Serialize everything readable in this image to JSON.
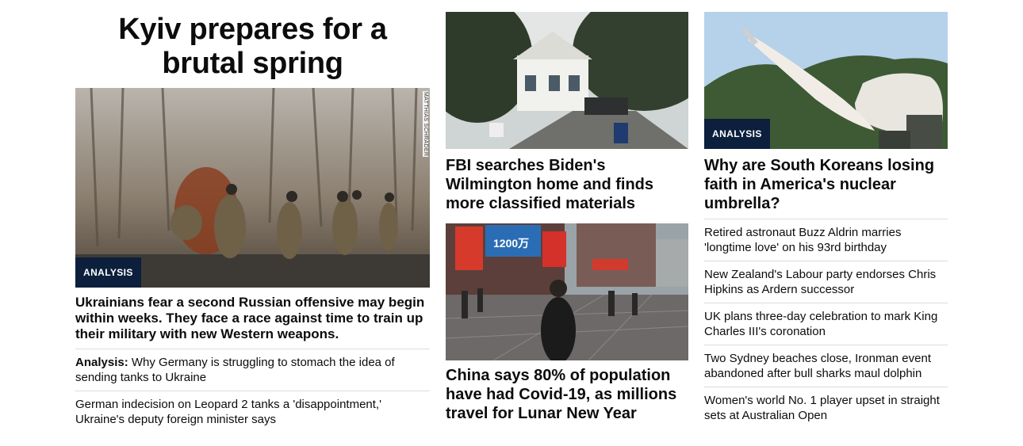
{
  "left": {
    "section_title": "Kyiv prepares for a brutal spring",
    "photo_credit": "MATTHIAS SCHRADER",
    "badge": "ANALYSIS",
    "lead_headline": "Ukrainians fear a second Russian offensive may begin within weeks. They face a race against time to train up their military with new Western weapons.",
    "links": [
      {
        "prefix": "Analysis:",
        "text": " Why Germany is struggling to stomach the idea of sending tanks to Ukraine"
      },
      {
        "prefix": "",
        "text": "German indecision on Leopard 2 tanks a 'disappointment,' Ukraine's deputy foreign minister says"
      }
    ]
  },
  "middle": {
    "card1": {
      "headline": "FBI searches Biden's Wilmington home and finds more classified materials",
      "image": "biden-home-photo"
    },
    "card2": {
      "headline": "China says 80% of population have had Covid-19, as millions travel for Lunar New Year",
      "image": "china-street-photo",
      "screen_text": "1200万"
    }
  },
  "right": {
    "card": {
      "badge": "ANALYSIS",
      "headline": "Why are South Koreans losing faith in America's nuclear umbrella?",
      "image": "missile-launch-photo"
    },
    "links": [
      "Retired astronaut Buzz Aldrin marries 'longtime love' on his 93rd birthday",
      "New Zealand's Labour party endorses Chris Hipkins as Ardern successor",
      "UK plans three-day celebration to mark King Charles III's coronation",
      "Two Sydney beaches close, Ironman event abandoned after bull sharks maul dolphin",
      "Women's world No. 1 player upset in straight sets at Australian Open"
    ]
  },
  "colors": {
    "badge_bg": "#0c1f3d",
    "text": "#0c0c0c",
    "divider": "#dcdcdc"
  }
}
